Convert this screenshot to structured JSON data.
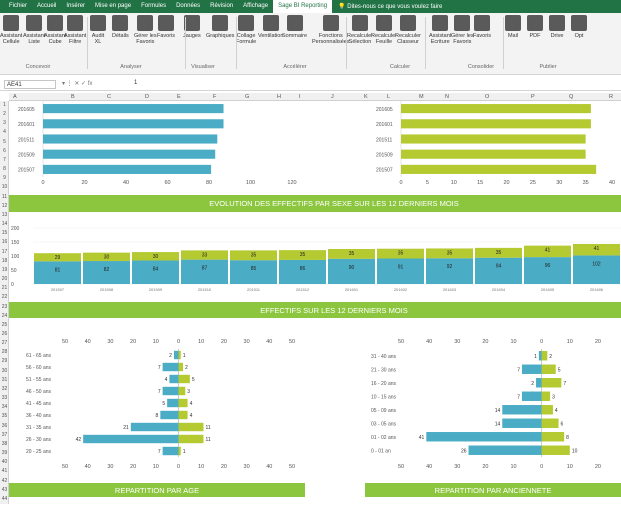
{
  "menu": {
    "tabs": [
      "Fichier",
      "Accueil",
      "Insérer",
      "Mise en page",
      "Formules",
      "Données",
      "Révision",
      "Affichage",
      "Sage BI Reporting"
    ],
    "active": 8,
    "tellme": "Dites-nous ce que vous voulez faire"
  },
  "ribbon": {
    "buttons": [
      {
        "l1": "Assistant",
        "l2": "Cellule"
      },
      {
        "l1": "Assistant",
        "l2": "Liste"
      },
      {
        "l1": "Assistant",
        "l2": "Cube"
      },
      {
        "l1": "Assistant",
        "l2": "Filtre"
      },
      {
        "l1": "Audit",
        "l2": "XL"
      },
      {
        "l1": "Détails",
        "l2": ""
      },
      {
        "l1": "Gérer les",
        "l2": "Favoris"
      },
      {
        "l1": "Favoris",
        "l2": ""
      },
      {
        "l1": "Jauges",
        "l2": ""
      },
      {
        "l1": "Graphiques",
        "l2": ""
      },
      {
        "l1": "Collage",
        "l2": "Formule"
      },
      {
        "l1": "Ventilation",
        "l2": ""
      },
      {
        "l1": "Sommaire",
        "l2": ""
      },
      {
        "l1": "Fonctions",
        "l2": "Personnalisées"
      },
      {
        "l1": "Recalculer",
        "l2": "Sélection"
      },
      {
        "l1": "Recalculer",
        "l2": "Feuille"
      },
      {
        "l1": "Recalculer",
        "l2": "Classeur"
      },
      {
        "l1": "Assistant",
        "l2": "Ecriture"
      },
      {
        "l1": "Gérer les",
        "l2": "Favoris"
      },
      {
        "l1": "Favoris",
        "l2": ""
      },
      {
        "l1": "Mail",
        "l2": ""
      },
      {
        "l1": "PDF",
        "l2": ""
      },
      {
        "l1": "Drive",
        "l2": ""
      },
      {
        "l1": "Opt",
        "l2": ""
      }
    ],
    "groups": [
      "Concevoir",
      "Analyser",
      "Visualiser",
      "Accélérer",
      "Calculer",
      "Consolider",
      "Publier"
    ]
  },
  "formula": {
    "cell": "AE41",
    "value": "1",
    "icons": "▾  ⋮  ✕  ✓  fx"
  },
  "columns": [
    "A",
    "B",
    "C",
    "D",
    "E",
    "F",
    "G",
    "H",
    "I",
    "J",
    "K",
    "L",
    "M",
    "N",
    "O",
    "P",
    "Q",
    "R"
  ],
  "rows": [
    "1",
    "2",
    "3",
    "4",
    "5",
    "6",
    "7",
    "8",
    "9",
    "10",
    "11",
    "12",
    "13",
    "14",
    "15",
    "16",
    "17",
    "18",
    "19",
    "20",
    "21",
    "22",
    "23",
    "24",
    "25",
    "26",
    "27",
    "28",
    "29",
    "30",
    "31",
    "32",
    "33",
    "34",
    "35",
    "36",
    "37",
    "38",
    "39",
    "40",
    "41",
    "42",
    "43",
    "44"
  ],
  "colors": {
    "blue": "#4bacc6",
    "green": "#b5c931",
    "band": "#8cc63f",
    "axis": "#999999"
  },
  "chart_data": [
    {
      "type": "bar",
      "orientation": "horizontal",
      "series_color": "blue",
      "categories": [
        "201605",
        "201601",
        "201511",
        "201509",
        "201507"
      ],
      "values": [
        87,
        87,
        84,
        83,
        81
      ],
      "x_ticks": [
        0,
        20,
        40,
        60,
        80,
        100,
        120
      ],
      "xlim": [
        0,
        120
      ]
    },
    {
      "type": "bar",
      "orientation": "horizontal",
      "series_color": "green",
      "categories": [
        "201605",
        "201601",
        "201511",
        "201509",
        "201507"
      ],
      "values": [
        36,
        36,
        35,
        35,
        37
      ],
      "x_ticks": [
        0,
        5,
        10,
        15,
        20,
        25,
        30,
        35,
        40
      ],
      "xlim": [
        0,
        40
      ]
    },
    {
      "type": "bar",
      "stacked": true,
      "y_ticks": [
        0,
        50,
        100,
        150,
        200
      ],
      "ylim": [
        0,
        200
      ],
      "title": "EVOLUTION DES EFFECTIFS PAR SEXE SUR LES 12 DERNIERS MOIS",
      "categories": [
        "201507",
        "201508",
        "201509",
        "201510",
        "201511",
        "201512",
        "201601",
        "201602",
        "201603",
        "201604",
        "201605",
        "201606"
      ],
      "series": [
        {
          "color": "blue",
          "values": [
            81,
            82,
            84,
            87,
            85,
            86,
            90,
            91,
            92,
            94,
            96,
            102
          ]
        },
        {
          "color": "green",
          "values": [
            29,
            30,
            30,
            33,
            35,
            35,
            35,
            35,
            35,
            35,
            41,
            41
          ]
        }
      ]
    },
    {
      "type": "bar",
      "orientation": "horizontal",
      "pyramid": true,
      "title": "EFFECTIFS SUR LES 12 DERNIERS MOIS",
      "categories": [
        "61 - 65 ans",
        "56 - 60 ans",
        "51 - 55 ans",
        "46 - 50 ans",
        "41 - 45 ans",
        "36 - 40 ans",
        "31 - 35 ans",
        "26 - 30 ans",
        "20 - 25 ans"
      ],
      "left": [
        2,
        7,
        4,
        7,
        5,
        8,
        21,
        42,
        7
      ],
      "right": [
        1,
        2,
        5,
        3,
        4,
        4,
        11,
        11,
        1
      ],
      "x_ticks": [
        50,
        40,
        30,
        20,
        10,
        0,
        10,
        20,
        30,
        40,
        50
      ],
      "xlim": [
        -50,
        50
      ],
      "footer": "REPARTITION PAR AGE"
    },
    {
      "type": "bar",
      "orientation": "horizontal",
      "pyramid": true,
      "categories": [
        "31 - 40 ans",
        "21 - 30 ans",
        "16 - 20 ans",
        "10 - 15 ans",
        "05 - 09 ans",
        "03 - 05 ans",
        "01 - 02 ans",
        "0 - 01 an"
      ],
      "left": [
        1,
        7,
        2,
        7,
        14,
        14,
        41,
        26
      ],
      "right": [
        2,
        5,
        7,
        3,
        4,
        6,
        8,
        10
      ],
      "x_ticks": [
        50,
        40,
        30,
        20,
        10,
        0,
        10,
        20
      ],
      "xlim": [
        -50,
        25
      ],
      "footer": "REPARTITION PAR ANCIENNETE"
    }
  ]
}
